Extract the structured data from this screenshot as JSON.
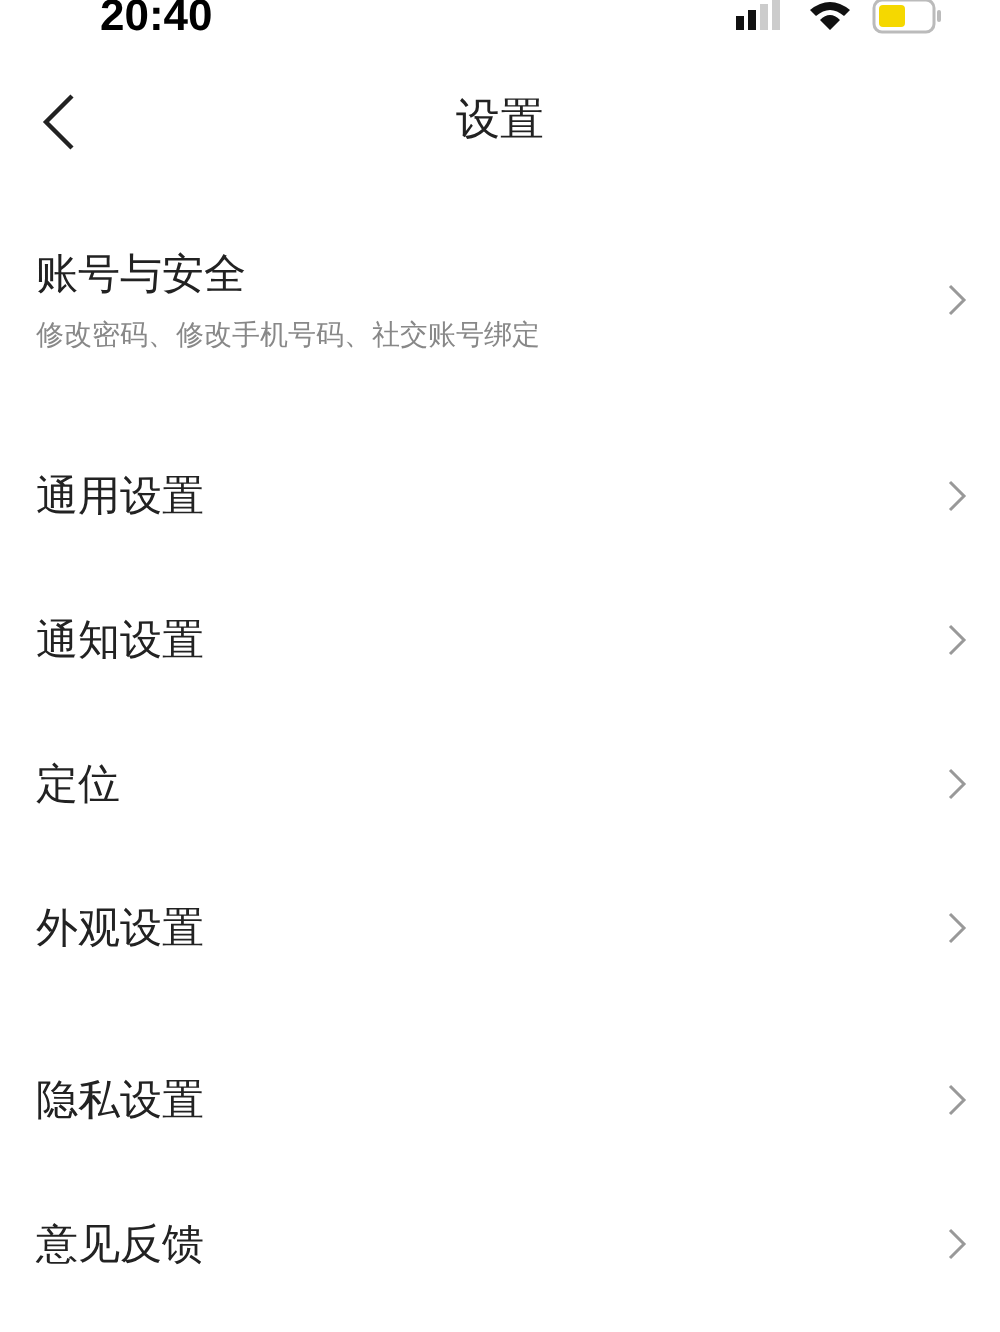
{
  "status_bar": {
    "time": "20:40"
  },
  "nav": {
    "title": "设置"
  },
  "items": [
    {
      "title": "账号与安全",
      "subtitle": "修改密码、修改手机号码、社交账号绑定"
    },
    {
      "title": "通用设置"
    },
    {
      "title": "通知设置"
    },
    {
      "title": "定位"
    },
    {
      "title": "外观设置"
    },
    {
      "title": "隐私设置"
    },
    {
      "title": "意见反馈"
    }
  ]
}
